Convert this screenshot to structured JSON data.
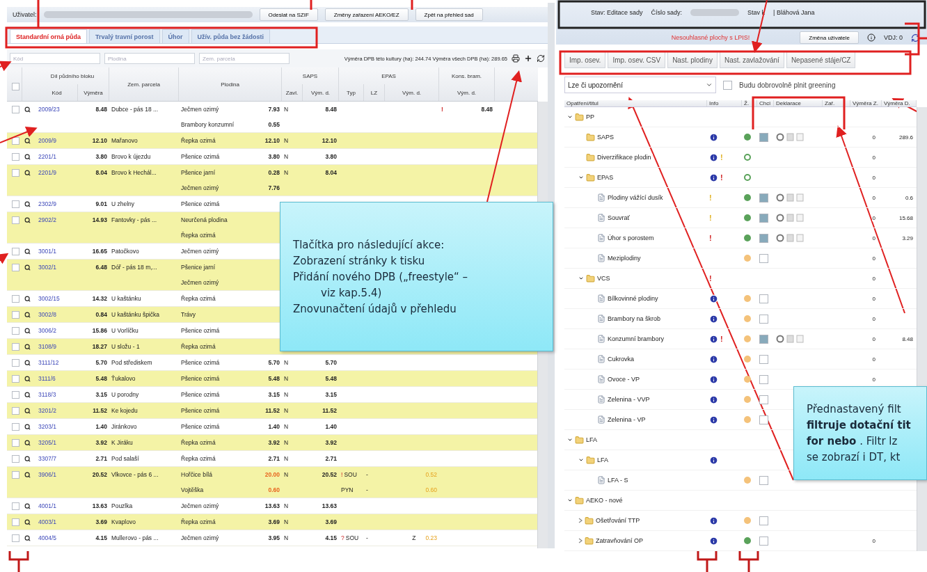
{
  "user_bar": {
    "label": "Uživatel:",
    "buttons": [
      "Odeslat na SZIF",
      "Změny zařazení AEKO/EZ",
      "Zpět na přehled sad"
    ]
  },
  "tabs": [
    {
      "label": "Standardní orná půda",
      "selected": true
    },
    {
      "label": "Trvalý travní porost",
      "selected": false
    },
    {
      "label": "Úhor",
      "selected": false
    },
    {
      "label": "Užív. půda bez žádosti",
      "selected": false
    }
  ],
  "filters": [
    {
      "placeholder": "Kód"
    },
    {
      "placeholder": "Plodina"
    },
    {
      "placeholder": "Zem. parcela"
    }
  ],
  "totals": "Výměra DPB této kultury (ha): 244.74   Výměra všech DPB (ha): 289.65",
  "select_all": {
    "checked": false
  },
  "columns": {
    "dpb": "Díl půdního bloku",
    "code": "Kód",
    "area": "Výměra",
    "parcel": "Zem. parcela",
    "crop": "Plodina",
    "saps": "SAPS",
    "saps_irrigation": "Zavl.",
    "saps_area": "Vým. d.",
    "epas": "EPAS",
    "epas_type": "Typ",
    "epas_lz": "LZ",
    "epas_area": "Vým. d.",
    "potato": "Kons. bram.",
    "potato_area": "Vým. d."
  },
  "rows": [
    {
      "checked": false,
      "code": "2009/23",
      "area": "8.48",
      "parcel": "Dubce - pás 18 ...",
      "crops": [
        {
          "name": "Ječmen ozimý",
          "area": "7.93",
          "warn": false
        },
        {
          "name": "Brambory konzumní",
          "area": "0.55",
          "warn": false
        }
      ],
      "irrigation": "N",
      "saps_area": "8.48",
      "potato_flag": "!",
      "potato_area": "8.48"
    },
    {
      "checked": false,
      "code": "2009/9",
      "area": "12.10",
      "parcel": "Mařanovo",
      "crops": [
        {
          "name": "Řepka ozimá",
          "area": "12.10",
          "warn": false
        }
      ],
      "irrigation": "N",
      "saps_area": "12.10"
    },
    {
      "checked": false,
      "code": "2201/1",
      "area": "3.80",
      "parcel": "Brovo k újezdu",
      "crops": [
        {
          "name": "Pšenice ozimá",
          "area": "3.80",
          "warn": false
        }
      ],
      "irrigation": "N",
      "saps_area": "3.80"
    },
    {
      "checked": false,
      "code": "2201/9",
      "area": "8.04",
      "parcel": "Brovo k Hechál...",
      "crops": [
        {
          "name": "Pšenice jarní",
          "area": "0.28",
          "warn": false
        },
        {
          "name": "Ječmen ozimý",
          "area": "7.76",
          "warn": false
        }
      ],
      "irrigation": "N",
      "saps_area": "8.04"
    },
    {
      "checked": false,
      "code": "2302/9",
      "area": "9.01",
      "parcel": "U zhelny",
      "crops": [
        {
          "name": "Pšenice ozimá"
        }
      ]
    },
    {
      "checked": false,
      "code": "2902/2",
      "area": "14.93",
      "parcel": "Fantovky - pás ...",
      "crops": [
        {
          "name": "Neurčená plodina"
        },
        {
          "name": "Řepka ozimá"
        }
      ]
    },
    {
      "checked": false,
      "code": "3001/1",
      "area": "16.65",
      "parcel": "Patočkovo",
      "crops": [
        {
          "name": "Ječmen ozimý"
        }
      ]
    },
    {
      "checked": false,
      "code": "3002/1",
      "area": "6.48",
      "parcel": "Dóř - pás 18 m,...",
      "crops": [
        {
          "name": "Pšenice jarní"
        },
        {
          "name": "Ječmen ozimý"
        }
      ]
    },
    {
      "checked": false,
      "code": "3002/15",
      "area": "14.32",
      "parcel": "U kaštánku",
      "crops": [
        {
          "name": "Řepka ozimá"
        }
      ]
    },
    {
      "checked": false,
      "code": "3002/8",
      "area": "0.84",
      "parcel": "U kaštánku špička",
      "crops": [
        {
          "name": "Trávy"
        }
      ]
    },
    {
      "checked": false,
      "code": "3006/2",
      "area": "15.86",
      "parcel": "U Vorlíčku",
      "crops": [
        {
          "name": "Pšenice ozimá"
        }
      ]
    },
    {
      "checked": false,
      "code": "3108/9",
      "area": "18.27",
      "parcel": "U složu - 1",
      "crops": [
        {
          "name": "Řepka ozimá"
        }
      ]
    },
    {
      "checked": false,
      "code": "3111/12",
      "area": "5.70",
      "parcel": "Pod střediskem",
      "crops": [
        {
          "name": "Pšenice ozimá",
          "area": "5.70",
          "warn": false
        }
      ],
      "irrigation": "N",
      "saps_area": "5.70"
    },
    {
      "checked": false,
      "code": "3111/6",
      "area": "5.48",
      "parcel": "Ťukalovo",
      "crops": [
        {
          "name": "Pšenice ozimá",
          "area": "5.48",
          "warn": false
        }
      ],
      "irrigation": "N",
      "saps_area": "5.48"
    },
    {
      "checked": false,
      "code": "3118/3",
      "area": "3.15",
      "parcel": "U porodny",
      "crops": [
        {
          "name": "Pšenice ozimá",
          "area": "3.15",
          "warn": false
        }
      ],
      "irrigation": "N",
      "saps_area": "3.15"
    },
    {
      "checked": false,
      "code": "3201/2",
      "area": "11.52",
      "parcel": "Ke kojedu",
      "crops": [
        {
          "name": "Pšenice ozimá",
          "area": "11.52",
          "warn": false
        }
      ],
      "irrigation": "N",
      "saps_area": "11.52"
    },
    {
      "checked": false,
      "code": "3203/1",
      "area": "1.40",
      "parcel": "Jiránkovo",
      "crops": [
        {
          "name": "Pšenice ozimá",
          "area": "1.40",
          "warn": false
        }
      ],
      "irrigation": "N",
      "saps_area": "1.40"
    },
    {
      "checked": false,
      "code": "3205/1",
      "area": "3.92",
      "parcel": "K Jiráku",
      "crops": [
        {
          "name": "Řepka ozimá",
          "area": "3.92",
          "warn": false
        }
      ],
      "irrigation": "N",
      "saps_area": "3.92"
    },
    {
      "checked": false,
      "code": "3307/7",
      "area": "2.71",
      "parcel": "Pod salaší",
      "crops": [
        {
          "name": "Řepka ozimá",
          "area": "2.71",
          "warn": false
        }
      ],
      "irrigation": "N",
      "saps_area": "2.71"
    },
    {
      "checked": false,
      "code": "3906/1",
      "area": "20.52",
      "parcel": "Vlkovce - pás 6 ...",
      "crops": [
        {
          "name": "Hořčice bílá",
          "area": "20.00",
          "warn": true
        },
        {
          "name": "Vojtěška",
          "area": "0.60",
          "warn": true
        }
      ],
      "irrigation": "N",
      "saps_area": "20.52",
      "epas": [
        {
          "flag": "!",
          "type": "SOU",
          "lz": "-",
          "area": "0.52"
        },
        {
          "type": "PYN",
          "lz": "-",
          "area": "0.60"
        }
      ]
    },
    {
      "checked": false,
      "code": "4001/1",
      "area": "13.63",
      "parcel": "Pouzlka",
      "crops": [
        {
          "name": "Ječmen ozimý",
          "area": "13.63",
          "warn": false
        }
      ],
      "irrigation": "N",
      "saps_area": "13.63"
    },
    {
      "checked": false,
      "code": "4003/1",
      "area": "3.69",
      "parcel": "Kvaplovo",
      "crops": [
        {
          "name": "Řepka ozimá",
          "area": "3.69",
          "warn": false
        }
      ],
      "irrigation": "N",
      "saps_area": "3.69"
    },
    {
      "checked": false,
      "code": "4004/5",
      "area": "4.15",
      "parcel": "Mullerovo - pás ...",
      "crops": [
        {
          "name": "Ječmen ozimý",
          "area": "3.95",
          "warn": false
        }
      ],
      "irrigation": "N",
      "saps_area": "4.15",
      "epas": [
        {
          "flag": "?",
          "type": "SOU",
          "lz": "-",
          "note": "Z",
          "area": "0.23"
        }
      ]
    }
  ],
  "set_bar": {
    "state": "Stav: Editace sady",
    "set_label": "Číslo sady:",
    "state_date": "Stav k",
    "user": "| Bláhová Jana",
    "warning": "Nesouhlasné plochy s LPIS!",
    "change_user": "Změna uživatele",
    "vdj": "VDJ: 0"
  },
  "actions": [
    "Imp. osev.",
    "Imp. osev. CSV",
    "Nast. plodiny",
    "Nast. zavlažování",
    "Nepasené stáje/CZ"
  ],
  "title_filter": {
    "value": "Lze či upozornění"
  },
  "greening": {
    "label": "Budu dobrovolně plnit greening",
    "checked": false
  },
  "tree": {
    "columns": [
      "Opatření/titul",
      "Info",
      "Ž.",
      "Chci",
      "Deklarace",
      "Zař.",
      "Výměra Z.",
      "Výměra D."
    ],
    "nodes": [
      {
        "kind": "folder",
        "label": "PP",
        "expanded": true,
        "children": [
          {
            "kind": "folder",
            "label": "SAPS",
            "info": true,
            "color": "#5aa25a",
            "filled": true,
            "chci": true,
            "area_z": "0",
            "area_d": "289.6"
          },
          {
            "kind": "folder",
            "label": "Diverzifikace plodin",
            "info": true,
            "alert": "!",
            "alert_severe": false,
            "color": "#5aa25a",
            "filled": false,
            "area_z": "0"
          },
          {
            "kind": "folder",
            "label": "EPAS",
            "expanded": true,
            "info": true,
            "alert": "!",
            "alert_severe": true,
            "color": "#5aa25a",
            "filled": false,
            "area_z": "0",
            "children": [
              {
                "kind": "leaf",
                "label": "Plodiny vážící dusík",
                "info": false,
                "alert": "!",
                "alert_severe": false,
                "color": "#5aa25a",
                "filled": true,
                "chci": true,
                "area_z": "0",
                "area_d": "0.6"
              },
              {
                "kind": "leaf",
                "label": "Souvrať",
                "info": false,
                "alert": "!",
                "alert_severe": false,
                "color": "#5aa25a",
                "filled": true,
                "chci": true,
                "area_z": "0",
                "area_d": "15.68"
              },
              {
                "kind": "leaf",
                "label": "Úhor s porostem",
                "info": false,
                "alert": "!",
                "alert_severe": true,
                "color": "#5aa25a",
                "filled": true,
                "chci": true,
                "area_z": "0",
                "area_d": "3.29"
              },
              {
                "kind": "leaf",
                "label": "Meziplodiny",
                "info": false,
                "color": "#f4c27a",
                "filled": true,
                "chci": false,
                "area_z": "0"
              }
            ]
          },
          {
            "kind": "folder",
            "label": "VCS",
            "expanded": true,
            "info": false,
            "alert": "!",
            "alert_severe": true,
            "area_z": "0",
            "children": [
              {
                "kind": "leaf",
                "label": "Bílkovinné plodiny",
                "info": true,
                "color": "#f4c27a",
                "filled": true,
                "chci": false,
                "area_z": "0"
              },
              {
                "kind": "leaf",
                "label": "Brambory na škrob",
                "info": true,
                "color": "#f4c27a",
                "filled": true,
                "chci": false,
                "area_z": "0"
              },
              {
                "kind": "leaf",
                "label": "Konzumní brambory",
                "info": true,
                "alert": "!",
                "alert_severe": true,
                "color": "#f4c27a",
                "filled": true,
                "chci": true,
                "area_z": "0",
                "area_d": "8.48"
              },
              {
                "kind": "leaf",
                "label": "Cukrovka",
                "info": true,
                "color": "#f4c27a",
                "filled": true,
                "chci": false,
                "area_z": "0"
              },
              {
                "kind": "leaf",
                "label": "Ovoce - VP",
                "info": true,
                "color": "#f4c27a",
                "filled": true,
                "chci": false,
                "area_z": "0"
              },
              {
                "kind": "leaf",
                "label": "Zelenina - VVP",
                "info": true,
                "color": "#f4c27a",
                "filled": true,
                "chci": false
              },
              {
                "kind": "leaf",
                "label": "Zelenina - VP",
                "info": true,
                "color": "#f4c27a",
                "filled": true,
                "chci": false
              }
            ]
          }
        ]
      },
      {
        "kind": "folder",
        "label": "LFA",
        "expanded": true,
        "children": [
          {
            "kind": "folder",
            "label": "LFA",
            "expanded": true,
            "info": true,
            "children": [
              {
                "kind": "leaf",
                "label": "LFA - S",
                "info": false,
                "color": "#f4c27a",
                "filled": true,
                "chci": false
              }
            ]
          }
        ]
      },
      {
        "kind": "folder",
        "label": "AEKO - nové",
        "expanded": true,
        "children": [
          {
            "kind": "folder",
            "label": "Ošetřování TTP",
            "expanded": false,
            "info": true,
            "color": "#f4c27a",
            "filled": true,
            "chci": false
          },
          {
            "kind": "folder",
            "label": "Zatravňování OP",
            "expanded": false,
            "info": true,
            "color": "#5aa25a",
            "filled": true,
            "chci": false,
            "area_z": "0"
          }
        ]
      }
    ]
  },
  "callouts": [
    {
      "lines": [
        {
          "text": "Tlačítka pro následující akce:",
          "indent": false
        },
        {
          "text": "Zobrazení stránky k tisku",
          "indent": false
        },
        {
          "text": "Přidání nového DPB („freestyle“ –",
          "indent": false
        },
        {
          "text": "viz kap.5.4)",
          "indent": true
        },
        {
          "text": "Znovunačtení údajů v přehledu",
          "indent": false
        }
      ]
    },
    {
      "lines": [
        {
          "text": "Přednastavený filt",
          "indent": false
        },
        {
          "text": "**filtruje dotační tit**",
          "indent": false
        },
        {
          "text": "**for   nebo** . Filtr lz",
          "indent": false
        },
        {
          "text": "se zobrazí i DT, kt",
          "indent": false
        }
      ]
    }
  ]
}
